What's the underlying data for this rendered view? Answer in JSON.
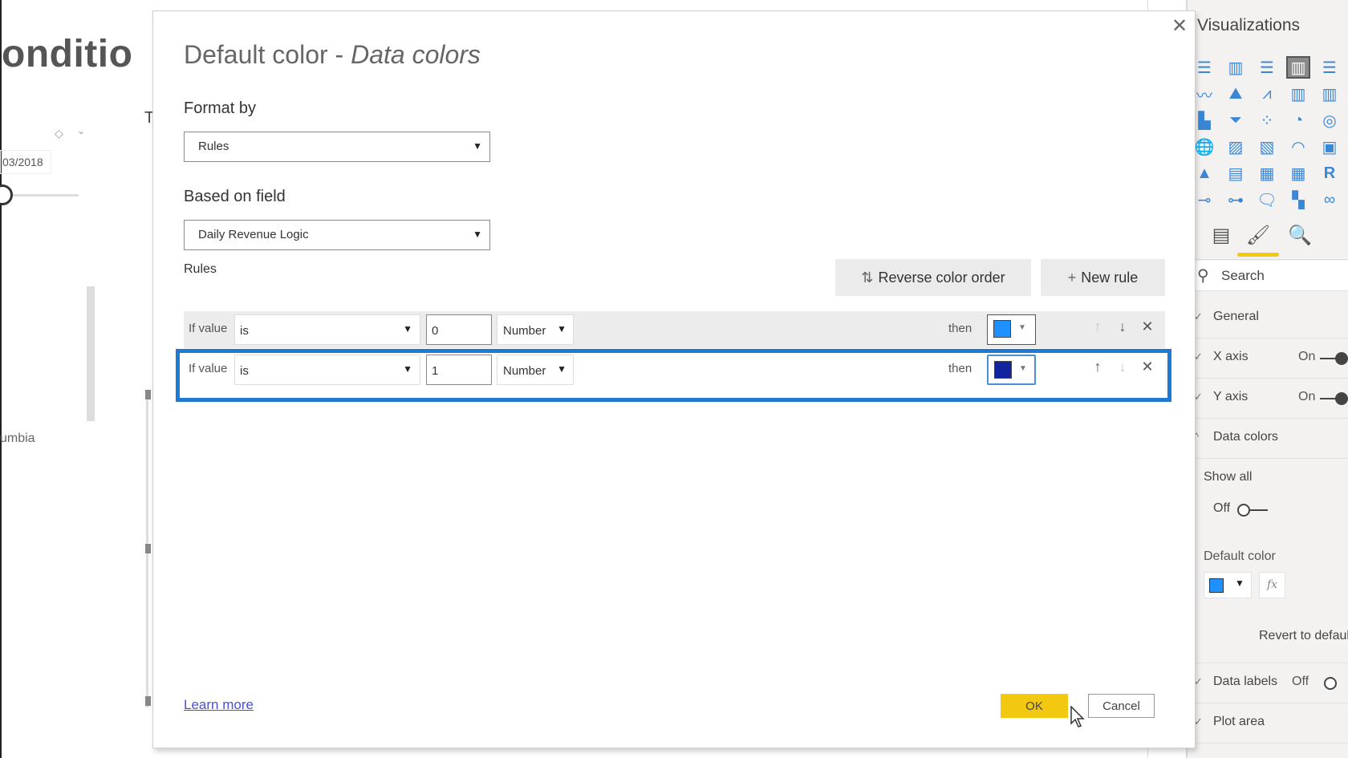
{
  "background": {
    "canvas_title_partial": "onditio",
    "canvas_letter": "T",
    "slicer_date": "03/2018",
    "axis_label_partial": "umbia"
  },
  "visualizations_pane": {
    "title": "Visualizations",
    "icons": [
      "stacked-bar-icon",
      "stacked-column-icon",
      "clustered-bar-icon",
      "clustered-column-icon",
      "100-stacked-bar-icon",
      "line-chart-icon",
      "area-chart-icon",
      "stacked-area-icon",
      "line-clustered-column-icon",
      "line-stacked-column-icon",
      "ribbon-chart-icon",
      "funnel-icon",
      "scatter-chart-icon",
      "pie-chart-icon",
      "donut-chart-icon",
      "map-icon",
      "filled-map-icon",
      "shape-map-icon",
      "gauge-icon",
      "card-icon",
      "kpi-icon",
      "slicer-icon",
      "table-icon",
      "matrix-icon",
      "r-visual-icon",
      "key-influencers-icon",
      "decomposition-tree-icon",
      "qa-icon",
      "arcgis-map-icon",
      "more-visuals-icon"
    ],
    "icon_glyphs": [
      "☰",
      "▥",
      "☰",
      "▥",
      "☰",
      "〰",
      "⛰",
      "⩘",
      "▥",
      "▥",
      "▙",
      "⏷",
      "⁘",
      "◔",
      "◎",
      "🌐",
      "▨",
      "▧",
      "◠",
      "▣",
      "▲",
      "▤",
      "▦",
      "▦",
      "R",
      "⊸",
      "⊶",
      "🗨",
      "▚",
      "∞"
    ],
    "selected_icon_index": 3,
    "tabs": [
      {
        "name": "fields-tab",
        "glyph": "▤"
      },
      {
        "name": "format-tab",
        "glyph": "🖌"
      },
      {
        "name": "analytics-tab",
        "glyph": "🔍"
      }
    ],
    "active_tab": "format-tab",
    "search_placeholder": "Search",
    "sections": [
      {
        "label": "General",
        "chevron": "✓",
        "value": ""
      },
      {
        "label": "X axis",
        "chevron": "✓",
        "value": "On"
      },
      {
        "label": "Y axis",
        "chevron": "✓",
        "value": "On"
      },
      {
        "label": "Data colors",
        "chevron": "^",
        "value": ""
      }
    ],
    "show_all_label": "Show all",
    "show_all_value": "Off",
    "default_color_label": "Default color",
    "default_color_value": "#1e90ff",
    "fx_label": "fx",
    "revert_label": "Revert to default",
    "data_labels_label": "Data labels",
    "data_labels_value": "Off",
    "plot_area_label": "Plot area"
  },
  "dialog": {
    "title_prefix": "Default color - ",
    "title_italic": "Data colors",
    "close_glyph": "✕",
    "format_by_label": "Format by",
    "format_by_value": "Rules",
    "based_on_field_label": "Based on field",
    "based_on_field_value": "Daily Revenue Logic",
    "rules_label": "Rules",
    "reverse_color_order_label": "Reverse color order",
    "reverse_glyph": "⇅",
    "new_rule_label": "New rule",
    "new_rule_glyph": "+",
    "rules": [
      {
        "prefix": "If value",
        "operator": "is",
        "value": "0",
        "type": "Number",
        "then_label": "then",
        "color": "#1e90ff",
        "move_up_enabled": false,
        "move_down_enabled": true
      },
      {
        "prefix": "If value",
        "operator": "is",
        "value": "1",
        "type": "Number",
        "then_label": "then",
        "color": "#12239e",
        "move_up_enabled": true,
        "move_down_enabled": false,
        "highlighted": true
      }
    ],
    "learn_more_label": "Learn more",
    "ok_label": "OK",
    "cancel_label": "Cancel"
  },
  "colors": {
    "highlight_border": "#1f78d1",
    "ok_button": "#f2c811",
    "link": "#4a50d8"
  }
}
